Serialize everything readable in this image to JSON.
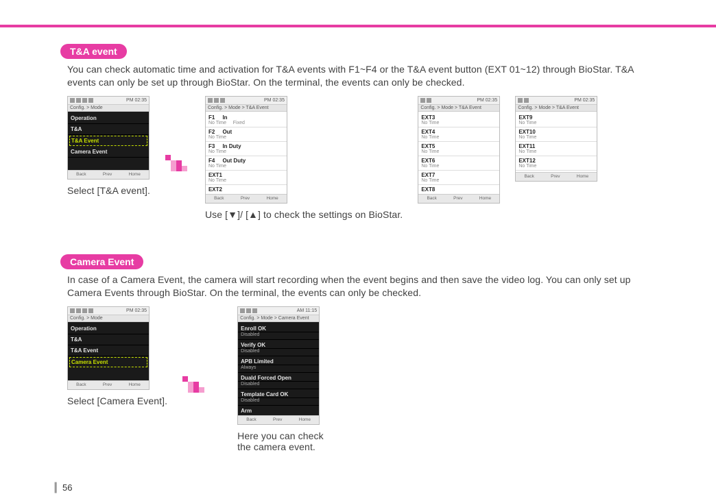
{
  "page_number": "56",
  "sections": {
    "ta": {
      "badge": "T&A event",
      "body": "You can check automatic time and activation for T&A events with F1~F4 or the T&A event button (EXT 01~12) through BioStar. T&A events can only be set up through BioStar. On the terminal, the events can only be checked.",
      "caption1": "Select [T&A event].",
      "caption2": "Use [▼]/ [▲] to check the settings on BioStar."
    },
    "cam": {
      "badge": "Camera Event",
      "body": "In case of a Camera Event, the camera will start recording when the event begins and then save the video log.  You can only set up Camera Events through BioStar. On the terminal, the events can only be checked.",
      "caption1": "Select [Camera Event].",
      "caption2a": "Here you can check",
      "caption2b": "the camera event."
    }
  },
  "phones": {
    "status_time": "PM 02:35",
    "status_time_am": "AM 11:15",
    "titlebar_mode": "Config. > Mode",
    "titlebar_ta": "Config. > Mode > T&A Event",
    "titlebar_cam": "Config. > Mode > Camera Event",
    "footer": {
      "back": "Back",
      "prev": "Prev",
      "home": "Home"
    },
    "menu": {
      "operation": "Operation",
      "ta": "T&A",
      "ta_event": "T&A Event",
      "camera_event": "Camera Event"
    },
    "ta_list": {
      "f1": "F1",
      "f1v": "In",
      "fixed": "Fixed",
      "f2": "F2",
      "f2v": "Out",
      "f3": "F3",
      "f3v": "In Duty",
      "f4": "F4",
      "f4v": "Out Duty",
      "e1": "EXT1",
      "e2": "EXT2",
      "e3": "EXT3",
      "e4": "EXT4",
      "e5": "EXT5",
      "e6": "EXT6",
      "e7": "EXT7",
      "e8": "EXT8",
      "e9": "EXT9",
      "e10": "EXT10",
      "e11": "EXT11",
      "e12": "EXT12",
      "notime": "No Time"
    },
    "cam_list": {
      "a": "Enroll OK",
      "b": "Verify OK",
      "c": "APB Limited",
      "d": "Duald Forced Open",
      "e": "Template Card OK",
      "f": "Arm",
      "disabled": "Disabled",
      "always": "Always"
    }
  }
}
